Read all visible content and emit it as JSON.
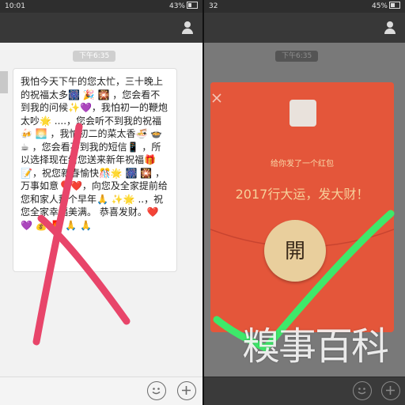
{
  "left_phone": {
    "status": {
      "time": "10:01",
      "battery": "43%",
      "battery_level": 0.43
    },
    "timestamp": "下午6:35",
    "message_text": "我怕今天下午的您太忙，三十晚上的祝福太多🎆 🎉 🎇 ，您会看不到我的问候✨💜，我怕初一的鞭炮太吵🌟 ....，您会听不到我的祝福🍻 🌅 ，我怕初二的菜太香🍜 🍲 ☕ ，您会看不到我的短信📱 ，所以选择现在给您送来新年祝福🎁📝，祝您新春愉快🎊🌟 🎆 🎇 ，万事如意🎈❤️，向您及全家提前给您和家人拜个早年🙏 ✨🌟 ..，祝您全家幸福美满。 恭喜发财。❤️💜 💰 🧧 🙏 🙏",
    "overlay_mark": "red-x"
  },
  "right_phone": {
    "status": {
      "time": "32",
      "battery": "45%",
      "battery_level": 0.45
    },
    "timestamp": "下午6:35",
    "envelope": {
      "subtitle": "给你发了一个红包",
      "greeting": "2017行大运，发大财！",
      "open_label": "開"
    },
    "overlay_mark": "green-check"
  },
  "watermark": "糗事百科",
  "colors": {
    "envelope": "#e4563a",
    "open_button": "#e9cf9d",
    "x_mark": "#e8456a",
    "check_mark": "#3ee86a"
  },
  "icons": [
    "person-icon",
    "emoji-icon",
    "plus-icon",
    "close-icon",
    "battery-icon"
  ]
}
